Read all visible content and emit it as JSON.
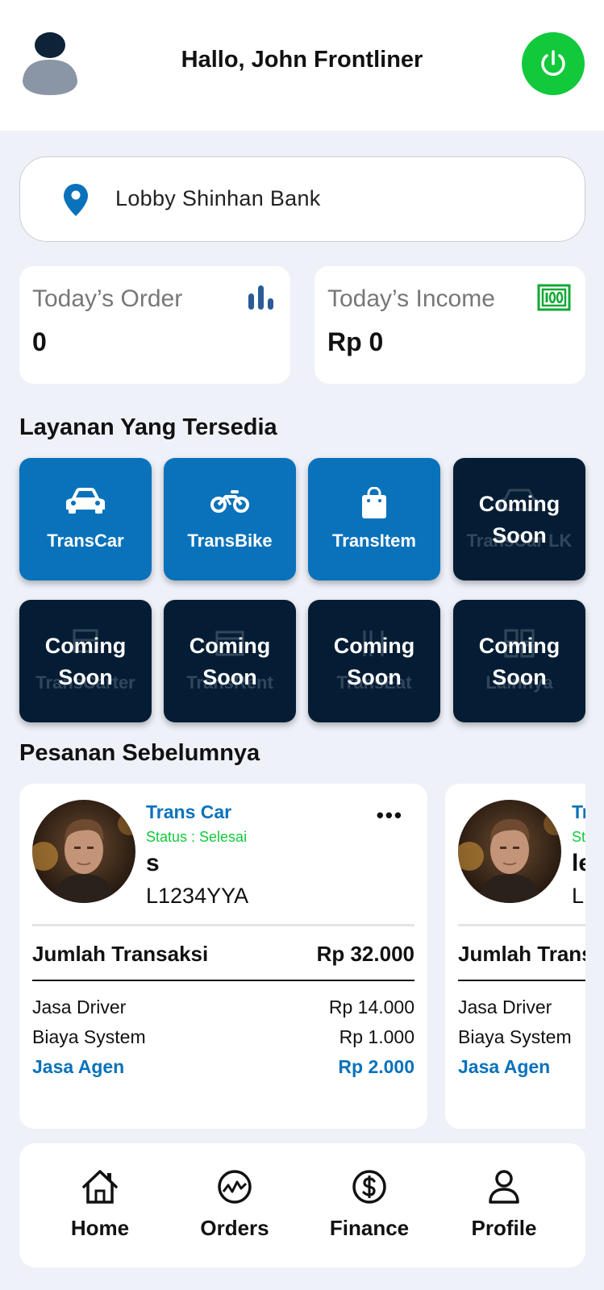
{
  "header": {
    "greeting": "Hallo, John Frontliner",
    "power_color": "#12c93b"
  },
  "location": {
    "icon": "location-pin-icon",
    "text": "Lobby Shinhan Bank"
  },
  "stats": [
    {
      "label": "Today’s Order",
      "value": "0",
      "icon": "bar-chart-icon"
    },
    {
      "label": "Today’s Income",
      "value": "Rp 0",
      "icon": "money-icon"
    }
  ],
  "services": {
    "title": "Layanan Yang Tersedia",
    "coming_soon": "Coming\nSoon",
    "items": [
      {
        "label": "TransCar",
        "icon": "car-icon",
        "available": true
      },
      {
        "label": "TransBike",
        "icon": "bike-icon",
        "available": true
      },
      {
        "label": "TransItem",
        "icon": "shopping-bag-icon",
        "available": true
      },
      {
        "label": "TransCar LK",
        "icon": "car-icon",
        "available": false
      },
      {
        "label": "TransCarter",
        "icon": "truck-icon",
        "available": false
      },
      {
        "label": "TransRent",
        "icon": "rent-icon",
        "available": false
      },
      {
        "label": "TransEat",
        "icon": "food-icon",
        "available": false
      },
      {
        "label": "Lainnya",
        "icon": "grid-icon",
        "available": false
      }
    ]
  },
  "orders": {
    "title": "Pesanan Sebelumnya",
    "items": [
      {
        "service": "Trans Car",
        "status": "Status : Selesai",
        "name": "s",
        "plate": "L1234YYA",
        "total_label": "Jumlah Transaksi",
        "total_value": "Rp 32.000",
        "lines": [
          {
            "label": "Jasa Driver",
            "value": "Rp 14.000"
          },
          {
            "label": "Biaya System",
            "value": "Rp 1.000"
          },
          {
            "label": "Jasa Agen",
            "value": "Rp 2.000"
          }
        ]
      },
      {
        "service": "Trans Car",
        "status": "Status : Selesai",
        "name": "le",
        "plate": "L",
        "total_label": "Jumlah Transaksi",
        "total_value": "",
        "lines": [
          {
            "label": "Jasa Driver",
            "value": ""
          },
          {
            "label": "Biaya System",
            "value": ""
          },
          {
            "label": "Jasa Agen",
            "value": ""
          }
        ]
      }
    ]
  },
  "nav": [
    {
      "label": "Home",
      "icon": "home-icon"
    },
    {
      "label": "Orders",
      "icon": "orders-chart-icon"
    },
    {
      "label": "Finance",
      "icon": "dollar-icon"
    },
    {
      "label": "Profile",
      "icon": "profile-icon"
    }
  ],
  "colors": {
    "primary": "#0a72bb",
    "dark_tile": "#051d34",
    "success": "#12c93b",
    "background": "#eef1f8"
  }
}
